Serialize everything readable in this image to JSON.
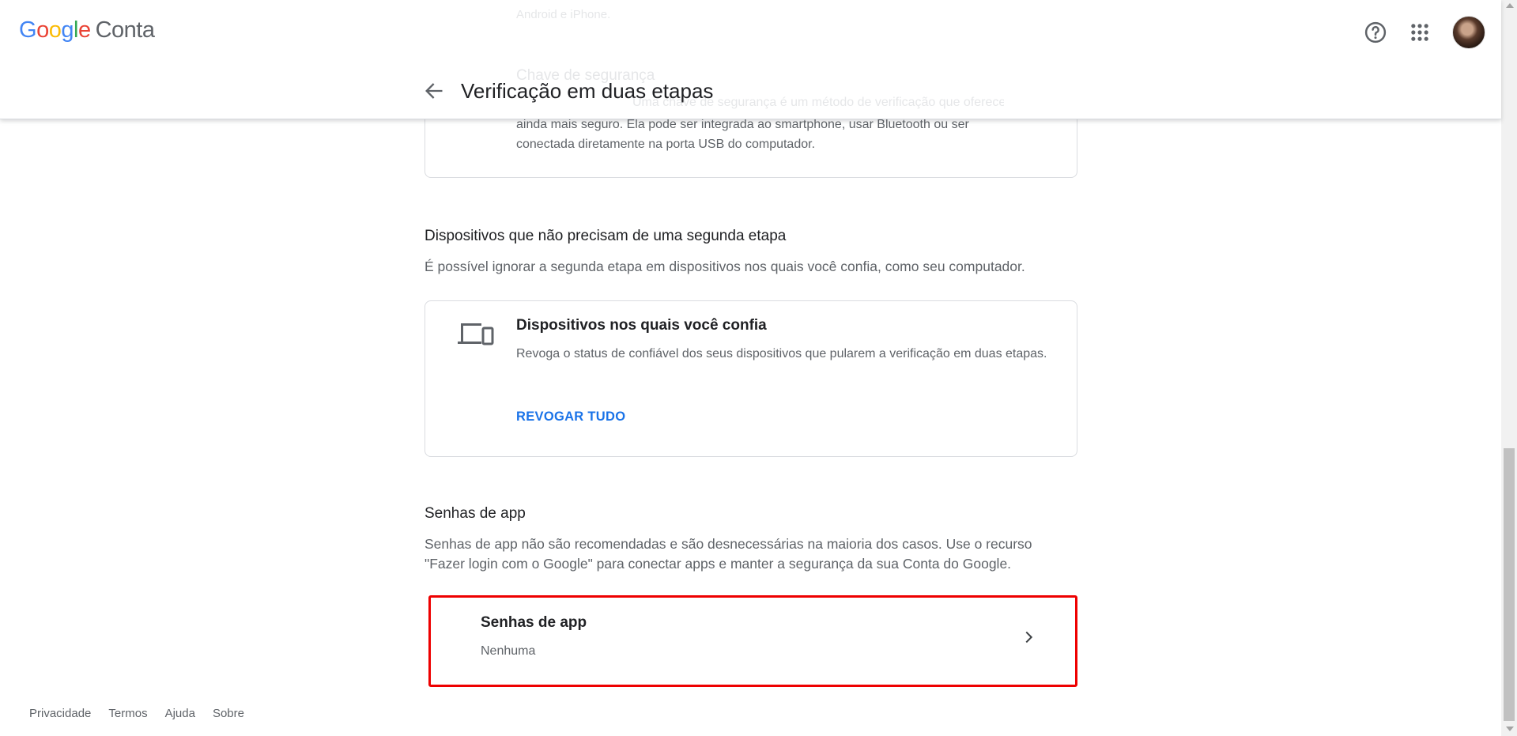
{
  "header": {
    "logo": {
      "g1": "G",
      "g2": "o",
      "g3": "o",
      "g4": "g",
      "g5": "l",
      "g6": "e",
      "product": "Conta"
    },
    "page_title": "Verificação em duas etapas"
  },
  "faded": {
    "android_text": "Android e iPhone.",
    "security_key_title": "Chave de segurança",
    "security_key_desc": "Uma chave de segurança é um método de verificação que oferece a você um login ainda mais seguro. Ela pode ser integrada ao smartphone, usar Bluetooth ou ser conectada diretamente na porta USB do computador."
  },
  "security_key_visible_desc": "ainda mais seguro. Ela pode ser integrada ao smartphone, usar Bluetooth ou ser conectada diretamente na porta USB do computador.",
  "devices_section": {
    "title": "Dispositivos que não precisam de uma segunda etapa",
    "description": "É possível ignorar a segunda etapa em dispositivos nos quais você confia, como seu computador.",
    "card": {
      "title": "Dispositivos nos quais você confia",
      "description": "Revoga o status de confiável dos seus dispositivos que pularem a verificação em duas etapas.",
      "button": "REVOGAR TUDO"
    }
  },
  "app_passwords_section": {
    "title": "Senhas de app",
    "description": "Senhas de app não são recomendadas e são desnecessárias na maioria dos casos. Use o recurso \"Fazer login com o Google\" para conectar apps e manter a segurança da sua Conta do Google.",
    "card": {
      "title": "Senhas de app",
      "value": "Nenhuma"
    }
  },
  "footer": {
    "privacy": "Privacidade",
    "terms": "Termos",
    "help": "Ajuda",
    "about": "Sobre"
  },
  "colors": {
    "link": "#1a73e8",
    "highlight": "#ee0000"
  }
}
